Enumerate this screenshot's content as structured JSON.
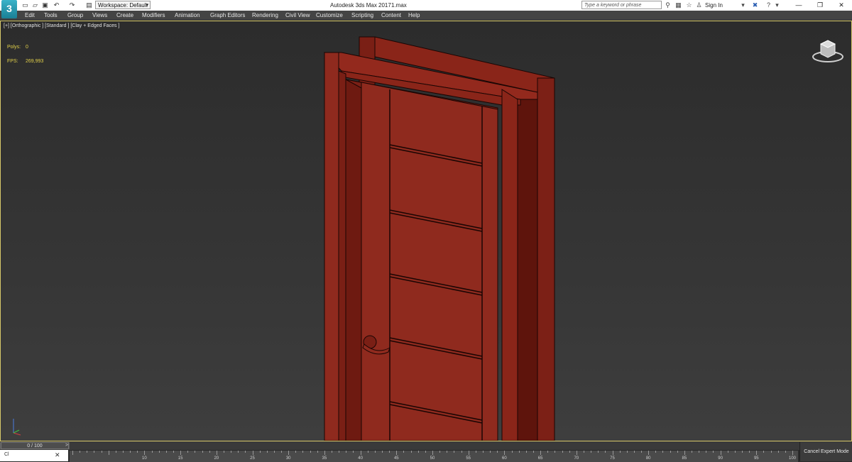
{
  "titlebar": {
    "workspace": "Workspace: Default",
    "app_title": "Autodesk 3ds Max 2017",
    "file_name": "1.max",
    "search_placeholder": "Type a keyword or phrase",
    "sign_in": "Sign In",
    "logo_glyph": "3"
  },
  "menu": [
    "Edit",
    "Tools",
    "Group",
    "Views",
    "Create",
    "Modifiers",
    "Animation",
    "Graph Editors",
    "Rendering",
    "Civil View",
    "Customize",
    "Scripting",
    "Content",
    "Help"
  ],
  "viewport": {
    "label": "[+] [Orthographic ] [Standard ] [Clay + Edged Faces ]",
    "polys_label": "Polys:",
    "polys_value": "0",
    "fps_label": "FPS:",
    "fps_value": "269,993"
  },
  "timeline": {
    "frame_display": "0 / 100",
    "next_glyph": ">",
    "ruler_labels": [
      "10",
      "15",
      "20",
      "25",
      "30",
      "35",
      "40",
      "45",
      "50",
      "55",
      "60",
      "65",
      "70",
      "75",
      "80",
      "85",
      "90",
      "95",
      "100"
    ],
    "cancel_expert": "Cancel Expert Mode"
  },
  "taskbar": {
    "app": "Cl",
    "close": "✕"
  },
  "colors": {
    "door": "#8f2a1e",
    "door_dark": "#5e140c",
    "accent": "#d8c96a",
    "stats": "#e3d14a"
  }
}
